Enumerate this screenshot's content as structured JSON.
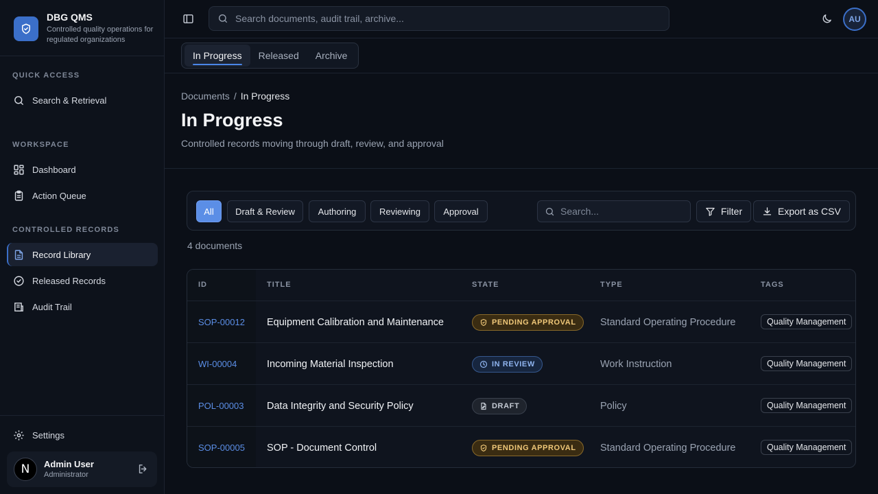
{
  "brand": {
    "name": "DBG QMS",
    "subtitle": "Controlled quality operations for regulated organizations"
  },
  "sidebar": {
    "sections": {
      "quick_access": "QUICK ACCESS",
      "workspace": "WORKSPACE",
      "controlled_records": "CONTROLLED RECORDS"
    },
    "items": {
      "search": "Search & Retrieval",
      "dashboard": "Dashboard",
      "action_queue": "Action Queue",
      "record_library": "Record Library",
      "released_records": "Released Records",
      "audit_trail": "Audit Trail",
      "settings": "Settings"
    },
    "user": {
      "initial": "N",
      "name": "Admin User",
      "role": "Administrator"
    }
  },
  "topbar": {
    "search_placeholder": "Search documents, audit trail, archive...",
    "avatar_initials": "AU"
  },
  "tabs": [
    "In Progress",
    "Released",
    "Archive"
  ],
  "breadcrumb": {
    "parent": "Documents",
    "separator": "/",
    "current": "In Progress"
  },
  "page": {
    "title": "In Progress",
    "subtitle": "Controlled records moving through draft, review, and approval"
  },
  "filters": {
    "chips": [
      "All",
      "Draft & Review",
      "Authoring",
      "Reviewing",
      "Approval"
    ],
    "active_chip": "All",
    "search_placeholder": "Search...",
    "filter_label": "Filter",
    "export_label": "Export as CSV"
  },
  "doc_count": "4 documents",
  "table": {
    "headers": {
      "id": "ID",
      "title": "TITLE",
      "state": "STATE",
      "type": "TYPE",
      "tags": "TAGS"
    },
    "rows": [
      {
        "id": "SOP-00012",
        "title": "Equipment Calibration and Maintenance",
        "state": "PENDING APPROVAL",
        "type": "Standard Operating Procedure",
        "tag": "Quality Management"
      },
      {
        "id": "WI-00004",
        "title": "Incoming Material Inspection",
        "state": "IN REVIEW",
        "type": "Work Instruction",
        "tag": "Quality Management"
      },
      {
        "id": "POL-00003",
        "title": "Data Integrity and Security Policy",
        "state": "DRAFT",
        "type": "Policy",
        "tag": "Quality Management"
      },
      {
        "id": "SOP-00005",
        "title": "SOP - Document Control",
        "state": "PENDING APPROVAL",
        "type": "Standard Operating Procedure",
        "tag": "Quality Management"
      }
    ]
  },
  "colors": {
    "accent": "#5b8ee6",
    "pending": "#f0c879",
    "review": "#8fb4ef",
    "draft": "#c4cad3"
  }
}
